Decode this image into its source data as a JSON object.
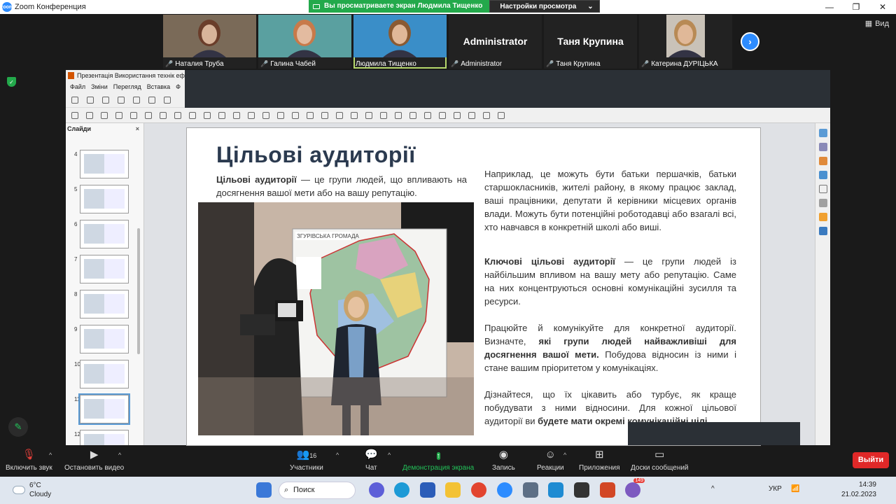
{
  "window": {
    "title": "Zoom Конференция",
    "logo_text": "zoom"
  },
  "share_banner": {
    "viewing": "Вы просматриваете экран Людмила Тищенко",
    "view_settings": "Настройки просмотра",
    "caret": "⌄"
  },
  "view_button": "Вид",
  "participants_strip": [
    {
      "name": "Наталия Труба",
      "muted": true,
      "video": true,
      "active": false,
      "bg": "#7a6a58",
      "face": "#d8b49a",
      "hair": "#6a3d2a"
    },
    {
      "name": "Галина Чабей",
      "muted": true,
      "video": true,
      "active": false,
      "bg": "#5aa0a0",
      "face": "#e3bba0",
      "hair": "#c87a4a"
    },
    {
      "name": "Людмила Тищенко",
      "muted": false,
      "video": true,
      "active": true,
      "bg": "#3a8ec8",
      "face": "#e0b898",
      "hair": "#8a5a32"
    },
    {
      "name": "Administrator",
      "muted": true,
      "video": false,
      "big_label": "Administrator"
    },
    {
      "name": "Таня Крупина",
      "muted": true,
      "video": false,
      "big_label": "Таня Крупина"
    },
    {
      "name": "Катерина ДУРІЦЬКА",
      "muted": true,
      "video": true,
      "active": false,
      "bg": "#c9c2b8",
      "face": "#e0b898",
      "hair": "#b88a55"
    }
  ],
  "next_arrow": "›",
  "libreoffice": {
    "title": "Презентація Використання технік ефект",
    "menu": [
      "Файл",
      "Зміни",
      "Перегляд",
      "Вставка",
      "Ф"
    ],
    "slides_panel_title": "Слайди",
    "close": "×",
    "slide_numbers": [
      "4",
      "5",
      "6",
      "7",
      "8",
      "9",
      "10",
      "11",
      "12"
    ]
  },
  "slide": {
    "title": "Цільові аудиторії",
    "intro_bold": "Цільові аудиторії",
    "intro_rest": " — це групи людей, що впливають на досягнення вашої мети або на вашу репутацію.",
    "p1": "Наприклад, це можуть бути батьки першачків, батьки старшокласників, жителі району, в якому працює заклад, ваші працівники, депутати й керівники місцевих органів влади. Можуть бути потенційні роботодавці або взагалі всі, хто навчався в конкретній школі або виші.",
    "p2_bold": "Ключові цільові аудиторії",
    "p2_rest": " — це групи людей із найбільшим впливом на вашу мету або репутацію. Саме на них концентруються основні комунікаційні зусилля та ресурси.",
    "p3_a": "Працюйте й комунікуйте для конкретної аудиторії. Визначте, ",
    "p3_bold": "які групи людей найважливіші для досягнення вашої мети.",
    "p3_b": " Побудова відносин із ними і стане вашим пріоритетом у комунікаціях.",
    "p4_a": "Дізнайтеся, що їх цікавить або турбує, як краще побудувати з ними відносини. Для кожної цільової аудиторії ви ",
    "p4_bold": "будете мати окремі комунікаційні цілі",
    "p4_b": ".",
    "map_label": "ЗГУРІВСЬКА ГРОМАДА"
  },
  "toolbar": {
    "mute": "Включить звук",
    "video": "Остановить видео",
    "participants": "Участники",
    "participants_count": "16",
    "chat": "Чат",
    "share": "Демонстрация экрана",
    "record": "Запись",
    "reactions": "Реакции",
    "apps": "Приложения",
    "whiteboards": "Доски сообщений",
    "leave": "Выйти"
  },
  "taskbar": {
    "temp": "6°C",
    "weather": "Cloudy",
    "search": "Поиск",
    "lang": "УКР",
    "time": "14:39",
    "date": "21.02.2023",
    "badge": "149"
  },
  "colors": {
    "zoom_blue": "#2d8cff",
    "share_green": "#23a94b",
    "leave_red": "#e02828",
    "slide_title": "#2b3a4f"
  }
}
